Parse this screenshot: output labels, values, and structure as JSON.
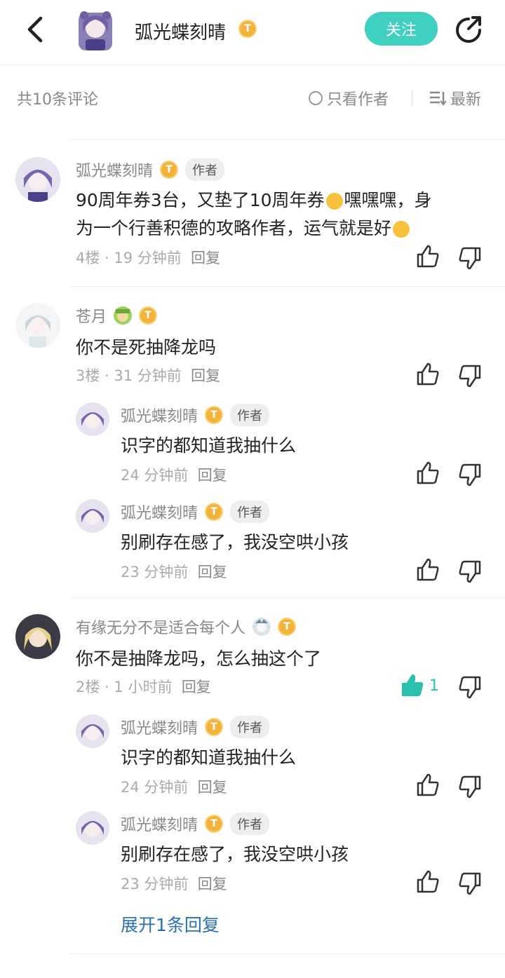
{
  "header": {
    "author_name": "弧光蝶刻晴",
    "badge_text": "T",
    "follow_label": "关注"
  },
  "filter": {
    "count_text": "共10条评论",
    "only_author_label": "只看作者",
    "sort_label": "最新"
  },
  "comments": [
    {
      "user": "弧光蝶刻晴",
      "badge": "T",
      "tag": "作者",
      "content_line1": "90周年券3台，又垫了10周年券",
      "content_line1_tail": "嘿嘿嘿，身",
      "content_line2": "为一个行善积德的攻略作者，运气就是好",
      "floor": "4楼",
      "time": "19 分钟前",
      "reply": "回复"
    },
    {
      "user": "苍月",
      "badge": "T",
      "content": "你不是死抽降龙吗",
      "floor": "3楼",
      "time": "31 分钟前",
      "reply": "回复",
      "replies": [
        {
          "user": "弧光蝶刻晴",
          "badge": "T",
          "tag": "作者",
          "content": "识字的都知道我抽什么",
          "time": "24 分钟前",
          "reply": "回复"
        },
        {
          "user": "弧光蝶刻晴",
          "badge": "T",
          "tag": "作者",
          "content": "别刷存在感了，我没空哄小孩",
          "time": "23 分钟前",
          "reply": "回复"
        }
      ]
    },
    {
      "user": "有缘无分不是适合每个人",
      "badge": "T",
      "content": "你不是抽降龙吗，怎么抽这个了",
      "floor": "2楼",
      "time": "1 小时前",
      "reply": "回复",
      "likes": "1",
      "replies": [
        {
          "user": "弧光蝶刻晴",
          "badge": "T",
          "tag": "作者",
          "content": "识字的都知道我抽什么",
          "time": "24 分钟前",
          "reply": "回复"
        },
        {
          "user": "弧光蝶刻晴",
          "badge": "T",
          "tag": "作者",
          "content": "别刷存在感了，我没空哄小孩",
          "time": "23 分钟前",
          "reply": "回复"
        }
      ]
    }
  ],
  "expand_label": "展开1条回复",
  "colors": {
    "accent": "#3fd0c0",
    "link": "#2a6fb0",
    "badge": "#f3b23c"
  }
}
